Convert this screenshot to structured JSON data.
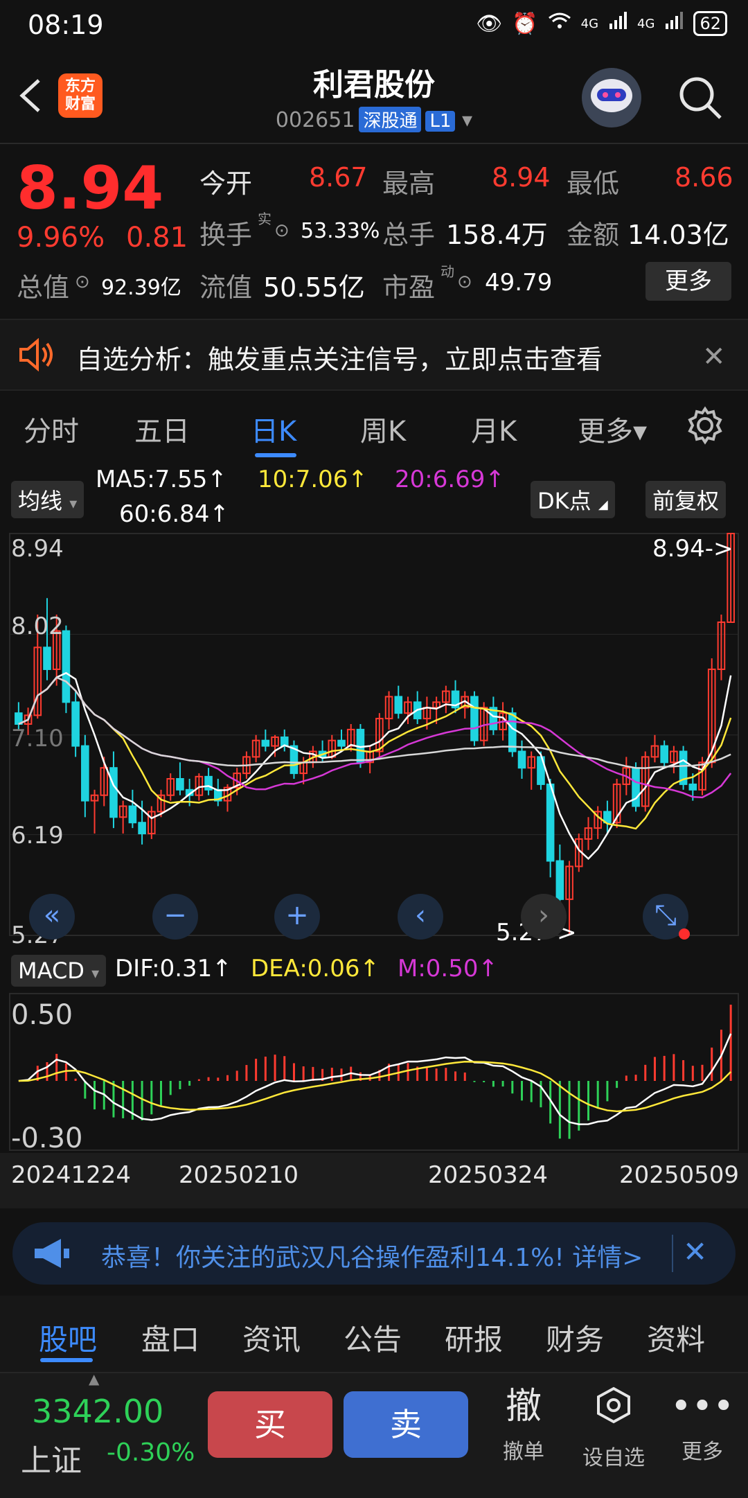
{
  "status_bar": {
    "time": "08:19",
    "battery": "62",
    "net1": "4G",
    "net2": "4G"
  },
  "header": {
    "title": "利君股份",
    "code": "002651",
    "tag1": "深股通",
    "tag2": "L1",
    "logo_text": "东方\n财富"
  },
  "quote": {
    "price": "8.94",
    "change_pct": "9.96%",
    "change": "0.81",
    "open_label": "今开",
    "open": "8.67",
    "high_label": "最高",
    "high": "8.94",
    "low_label": "最低",
    "low": "8.66",
    "turnover_label": "换手",
    "turnover_sup": "实",
    "turnover": "53.33%",
    "volume_label": "总手",
    "volume": "158.4万",
    "amount_label": "金额",
    "amount": "14.03亿",
    "mktcap_label": "总值",
    "mktcap": "92.39亿",
    "float_label": "流值",
    "float_val": "50.55亿",
    "pe_label": "市盈",
    "pe_sup": "动",
    "pe": "49.79",
    "more": "更多"
  },
  "banner": {
    "text": "自选分析：触发重点关注信号，立即点击查看",
    "icon": "speaker-icon"
  },
  "tabs": [
    "分时",
    "五日",
    "日K",
    "周K",
    "月K",
    "更多▾"
  ],
  "active_tab": "日K",
  "ma": {
    "chip": "均线",
    "ma5": "MA5:7.55↑",
    "ma10": "10:7.06↑",
    "ma20": "20:6.69↑",
    "ma60": "60:6.84↑",
    "dk": "DK点",
    "fq": "前复权"
  },
  "chart_data": {
    "type": "candlestick",
    "y_ticks": [
      "8.94",
      "8.02",
      "7.10",
      "6.19",
      "5.27"
    ],
    "max_label": "8.94->",
    "min_label": "5.27->",
    "ylim": [
      5.27,
      8.94
    ],
    "x_dates": [
      "20241224",
      "20250210",
      "20250324",
      "20250509"
    ],
    "colors": {
      "up": "#ff3b30",
      "down": "#1fd4e0",
      "ma5": "#ffffff",
      "ma10": "#ffe83a",
      "ma20": "#d638d6",
      "ma60": "#d8d8d8"
    },
    "candles": [
      [
        7.3,
        7.4,
        7.15,
        7.2
      ],
      [
        7.2,
        7.35,
        7.1,
        7.28
      ],
      [
        7.28,
        8.2,
        7.25,
        7.9
      ],
      [
        7.9,
        8.35,
        7.6,
        7.7
      ],
      [
        7.7,
        8.2,
        7.55,
        8.05
      ],
      [
        8.05,
        8.1,
        7.3,
        7.4
      ],
      [
        7.4,
        7.5,
        6.9,
        7.0
      ],
      [
        7.0,
        7.1,
        6.35,
        6.5
      ],
      [
        6.5,
        6.6,
        6.2,
        6.55
      ],
      [
        6.55,
        6.9,
        6.45,
        6.8
      ],
      [
        6.8,
        6.95,
        6.25,
        6.35
      ],
      [
        6.35,
        6.5,
        6.2,
        6.45
      ],
      [
        6.45,
        6.6,
        6.25,
        6.3
      ],
      [
        6.3,
        6.5,
        6.1,
        6.2
      ],
      [
        6.2,
        6.45,
        6.15,
        6.4
      ],
      [
        6.4,
        6.6,
        6.35,
        6.55
      ],
      [
        6.55,
        6.75,
        6.5,
        6.7
      ],
      [
        6.7,
        6.85,
        6.55,
        6.6
      ],
      [
        6.6,
        6.7,
        6.45,
        6.55
      ],
      [
        6.55,
        6.75,
        6.5,
        6.72
      ],
      [
        6.72,
        6.8,
        6.55,
        6.6
      ],
      [
        6.6,
        6.7,
        6.45,
        6.5
      ],
      [
        6.5,
        6.65,
        6.4,
        6.62
      ],
      [
        6.62,
        6.8,
        6.55,
        6.75
      ],
      [
        6.75,
        6.95,
        6.7,
        6.9
      ],
      [
        6.9,
        7.1,
        6.85,
        7.05
      ],
      [
        7.05,
        7.15,
        6.95,
        7.0
      ],
      [
        7.0,
        7.1,
        6.9,
        7.08
      ],
      [
        7.08,
        7.15,
        6.95,
        7.0
      ],
      [
        7.0,
        7.05,
        6.7,
        6.75
      ],
      [
        6.75,
        6.9,
        6.65,
        6.85
      ],
      [
        6.85,
        7.0,
        6.8,
        6.95
      ],
      [
        6.95,
        7.05,
        6.85,
        6.9
      ],
      [
        6.9,
        7.1,
        6.88,
        7.05
      ],
      [
        7.05,
        7.15,
        6.95,
        7.0
      ],
      [
        7.0,
        7.2,
        6.95,
        7.15
      ],
      [
        7.15,
        7.2,
        6.8,
        6.85
      ],
      [
        6.85,
        7.0,
        6.75,
        6.95
      ],
      [
        6.95,
        7.3,
        6.9,
        7.25
      ],
      [
        7.25,
        7.5,
        7.15,
        7.45
      ],
      [
        7.45,
        7.55,
        7.25,
        7.3
      ],
      [
        7.3,
        7.45,
        7.2,
        7.4
      ],
      [
        7.4,
        7.5,
        7.2,
        7.25
      ],
      [
        7.25,
        7.45,
        7.15,
        7.35
      ],
      [
        7.35,
        7.45,
        7.2,
        7.4
      ],
      [
        7.4,
        7.55,
        7.3,
        7.5
      ],
      [
        7.5,
        7.6,
        7.3,
        7.35
      ],
      [
        7.35,
        7.5,
        7.25,
        7.45
      ],
      [
        7.45,
        7.5,
        7.0,
        7.05
      ],
      [
        7.05,
        7.4,
        7.0,
        7.35
      ],
      [
        7.35,
        7.45,
        7.1,
        7.15
      ],
      [
        7.15,
        7.4,
        7.05,
        7.3
      ],
      [
        7.3,
        7.35,
        6.9,
        6.95
      ],
      [
        6.95,
        7.05,
        6.7,
        6.8
      ],
      [
        6.8,
        6.95,
        6.6,
        6.9
      ],
      [
        6.9,
        6.95,
        6.6,
        6.65
      ],
      [
        6.65,
        6.7,
        5.8,
        5.95
      ],
      [
        5.95,
        6.1,
        5.4,
        5.6
      ],
      [
        5.6,
        5.95,
        5.27,
        5.9
      ],
      [
        5.9,
        6.2,
        5.85,
        6.15
      ],
      [
        6.15,
        6.35,
        6.05,
        6.25
      ],
      [
        6.25,
        6.45,
        6.15,
        6.4
      ],
      [
        6.4,
        6.5,
        6.2,
        6.3
      ],
      [
        6.3,
        6.7,
        6.25,
        6.65
      ],
      [
        6.65,
        6.9,
        6.55,
        6.8
      ],
      [
        6.8,
        6.85,
        6.4,
        6.45
      ],
      [
        6.45,
        6.95,
        6.4,
        6.9
      ],
      [
        6.9,
        7.1,
        6.85,
        7.0
      ],
      [
        7.0,
        7.05,
        6.8,
        6.85
      ],
      [
        6.85,
        7.0,
        6.75,
        6.95
      ],
      [
        6.95,
        7.0,
        6.6,
        6.65
      ],
      [
        6.65,
        6.75,
        6.5,
        6.6
      ],
      [
        6.6,
        6.9,
        6.55,
        6.85
      ],
      [
        6.85,
        7.8,
        6.8,
        7.7
      ],
      [
        7.7,
        8.2,
        7.6,
        8.13
      ],
      [
        8.13,
        8.94,
        8.13,
        8.94
      ]
    ],
    "macd": {
      "dif": "DIF:0.31↑",
      "dea": "DEA:0.06↑",
      "m": "M:0.50↑",
      "y_ticks": [
        "0.50",
        "-0.30"
      ]
    }
  },
  "notice": {
    "text": "恭喜！你关注的武汉凡谷操作盈利14.1%! 详情>",
    "icon": "megaphone-icon"
  },
  "subtabs": [
    "股吧",
    "盘口",
    "资讯",
    "公告",
    "研报",
    "财务",
    "资料"
  ],
  "bottom": {
    "index_value": "3342.00",
    "index_name": "上证",
    "index_pct": "-0.30%",
    "buy": "买",
    "sell": "卖",
    "cancel_glyph": "撤",
    "cancel_label": "撤单",
    "watch_label": "设自选",
    "more_label": "更多"
  }
}
